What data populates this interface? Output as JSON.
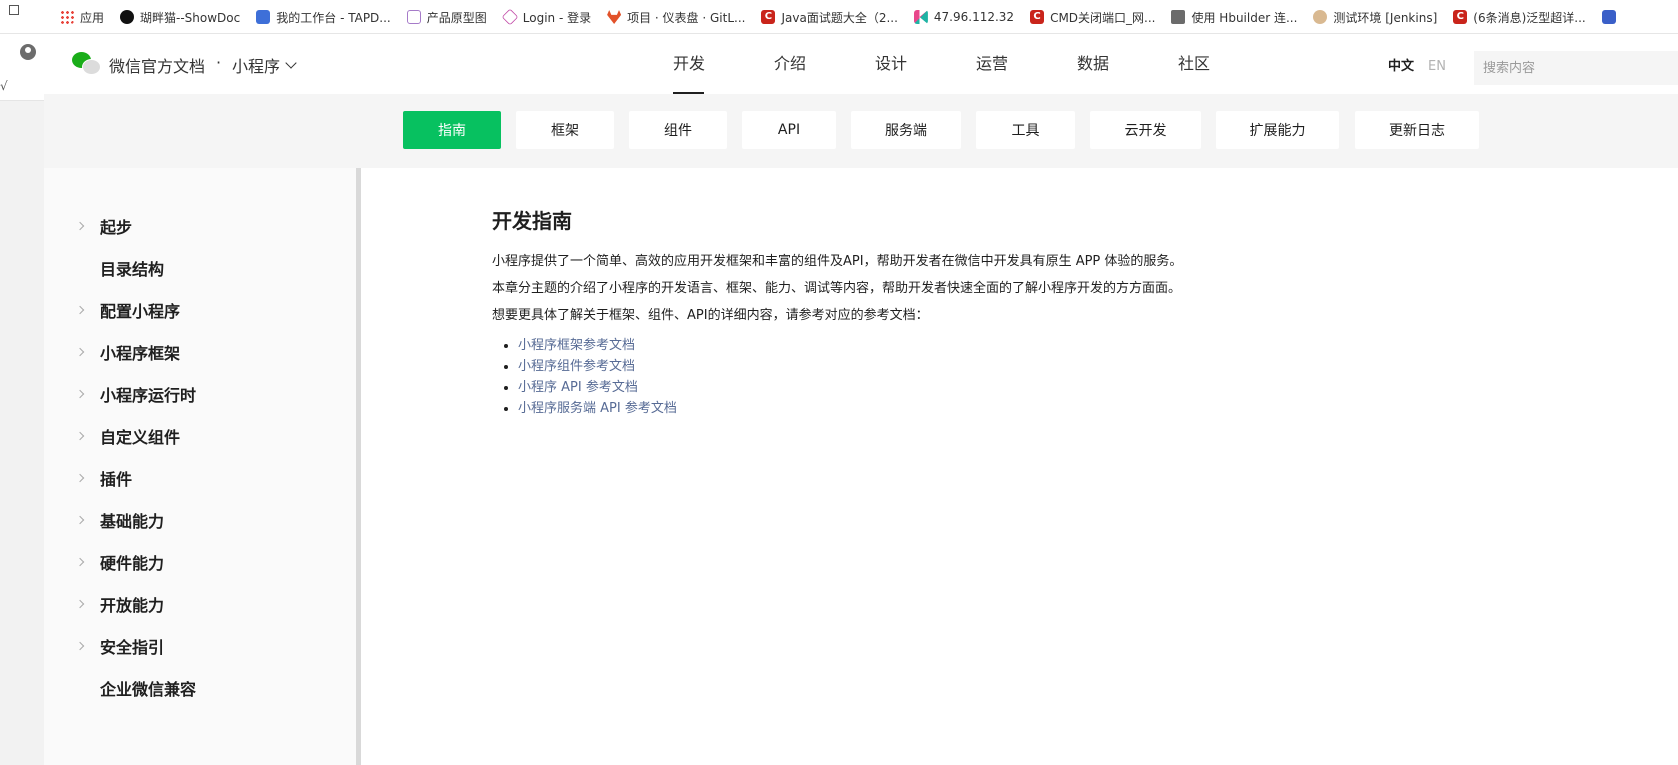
{
  "browser": {
    "bookmarks": [
      {
        "label": "应用",
        "icon": "apps-grid-icon"
      },
      {
        "label": "瑚畔猫--ShowDoc",
        "icon": "showdoc-icon"
      },
      {
        "label": "我的工作台 - TAPD...",
        "icon": "tapd-icon"
      },
      {
        "label": "产品原型图",
        "icon": "prototype-icon"
      },
      {
        "label": "Login - 登录",
        "icon": "login-icon"
      },
      {
        "label": "项目 · 仪表盘 · GitL...",
        "icon": "gitlab-icon"
      },
      {
        "label": "Java面试题大全（2...",
        "icon": "csdn-icon"
      },
      {
        "label": "47.96.112.32",
        "icon": "kibana-icon"
      },
      {
        "label": "CMD关闭端口_网...",
        "icon": "csdn-icon"
      },
      {
        "label": "使用 Hbuilder 连...",
        "icon": "avatar-icon"
      },
      {
        "label": "测试环境 [Jenkins]",
        "icon": "jenkins-icon"
      },
      {
        "label": "(6条消息)泛型超详...",
        "icon": "csdn-icon"
      }
    ],
    "left_strip_mark": "√"
  },
  "header": {
    "site_title": "微信官方文档",
    "separator": "·",
    "product": "小程序",
    "nav": [
      "开发",
      "介绍",
      "设计",
      "运营",
      "数据",
      "社区"
    ],
    "active_nav": "开发",
    "lang_zh": "中文",
    "lang_en": "EN",
    "search_placeholder": "搜索内容"
  },
  "subnav": {
    "items": [
      "指南",
      "框架",
      "组件",
      "API",
      "服务端",
      "工具",
      "云开发",
      "扩展能力",
      "更新日志"
    ],
    "active": "指南"
  },
  "sidebar": {
    "items": [
      {
        "label": "起步",
        "expandable": true
      },
      {
        "label": "目录结构",
        "expandable": false
      },
      {
        "label": "配置小程序",
        "expandable": true
      },
      {
        "label": "小程序框架",
        "expandable": true
      },
      {
        "label": "小程序运行时",
        "expandable": true
      },
      {
        "label": "自定义组件",
        "expandable": true
      },
      {
        "label": "插件",
        "expandable": true
      },
      {
        "label": "基础能力",
        "expandable": true
      },
      {
        "label": "硬件能力",
        "expandable": true
      },
      {
        "label": "开放能力",
        "expandable": true
      },
      {
        "label": "安全指引",
        "expandable": true
      },
      {
        "label": "企业微信兼容",
        "expandable": false
      }
    ]
  },
  "content": {
    "title": "开发指南",
    "paragraphs": [
      "小程序提供了一个简单、高效的应用开发框架和丰富的组件及API，帮助开发者在微信中开发具有原生 APP 体验的服务。",
      "本章分主题的介绍了小程序的开发语言、框架、能力、调试等内容，帮助开发者快速全面的了解小程序开发的方方面面。",
      "想要更具体了解关于框架、组件、API的详细内容，请参考对应的参考文档："
    ],
    "links": [
      "小程序框架参考文档",
      "小程序组件参考文档",
      "小程序 API 参考文档",
      "小程序服务端 API 参考文档"
    ]
  },
  "colors": {
    "brand_green": "#07c160",
    "link": "#576b95",
    "subnav_bg": "#f5f5f5"
  }
}
